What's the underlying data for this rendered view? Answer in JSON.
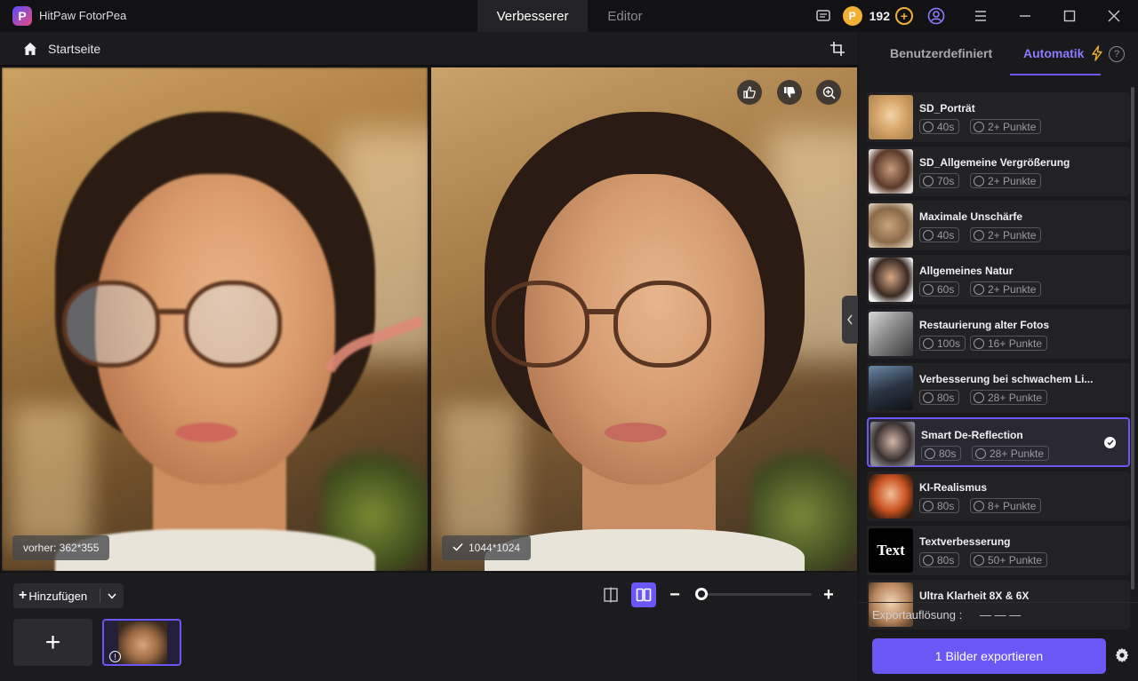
{
  "app": {
    "title": "HitPaw FotorPea",
    "logo_letter": "P",
    "tabs": [
      {
        "label": "Verbesserer",
        "active": true
      },
      {
        "label": "Editor",
        "active": false
      }
    ],
    "credits": "192",
    "coin_glyph": "P",
    "accent_color": "#6b56f6",
    "coin_color": "#f2b134"
  },
  "subheader": {
    "home_label": "Startseite"
  },
  "preview": {
    "before_badge": "vorher: 362*355",
    "after_badge": "1044*1024"
  },
  "bottom": {
    "add_label": "Hinzufügen",
    "add_plus": "+",
    "add_tile": "+",
    "zoom_level": 0.05
  },
  "panel": {
    "tabs": [
      {
        "label": "Benutzerdefiniert",
        "active": false
      },
      {
        "label": "Automatik",
        "active": true
      }
    ],
    "help_glyph": "?",
    "models": [
      {
        "name": "SD_Porträt",
        "time": "40s",
        "points": "2+ Punkte",
        "selected": false
      },
      {
        "name": "SD_Allgemeine Vergrößerung",
        "time": "70s",
        "points": "2+ Punkte",
        "selected": false
      },
      {
        "name": "Maximale Unschärfe",
        "time": "40s",
        "points": "2+ Punkte",
        "selected": false
      },
      {
        "name": "Allgemeines Natur",
        "time": "60s",
        "points": "2+ Punkte",
        "selected": false
      },
      {
        "name": "Restaurierung alter Fotos",
        "time": "100s",
        "points": "16+ Punkte",
        "selected": false
      },
      {
        "name": "Verbesserung bei schwachem Li...",
        "time": "80s",
        "points": "28+ Punkte",
        "selected": false
      },
      {
        "name": "Smart De-Reflection",
        "time": "80s",
        "points": "28+ Punkte",
        "selected": true
      },
      {
        "name": "KI-Realismus",
        "time": "80s",
        "points": "8+ Punkte",
        "selected": false
      },
      {
        "name": "Textverbesserung",
        "time": "80s",
        "points": "50+ Punkte",
        "selected": false,
        "thumb_text": "Text"
      },
      {
        "name": "Ultra Klarheit 8X & 6X",
        "time": "",
        "points": "",
        "selected": false
      }
    ],
    "export_label": "Exportauflösung :",
    "export_value": "— — —",
    "export_button": "1 Bilder exportieren"
  }
}
